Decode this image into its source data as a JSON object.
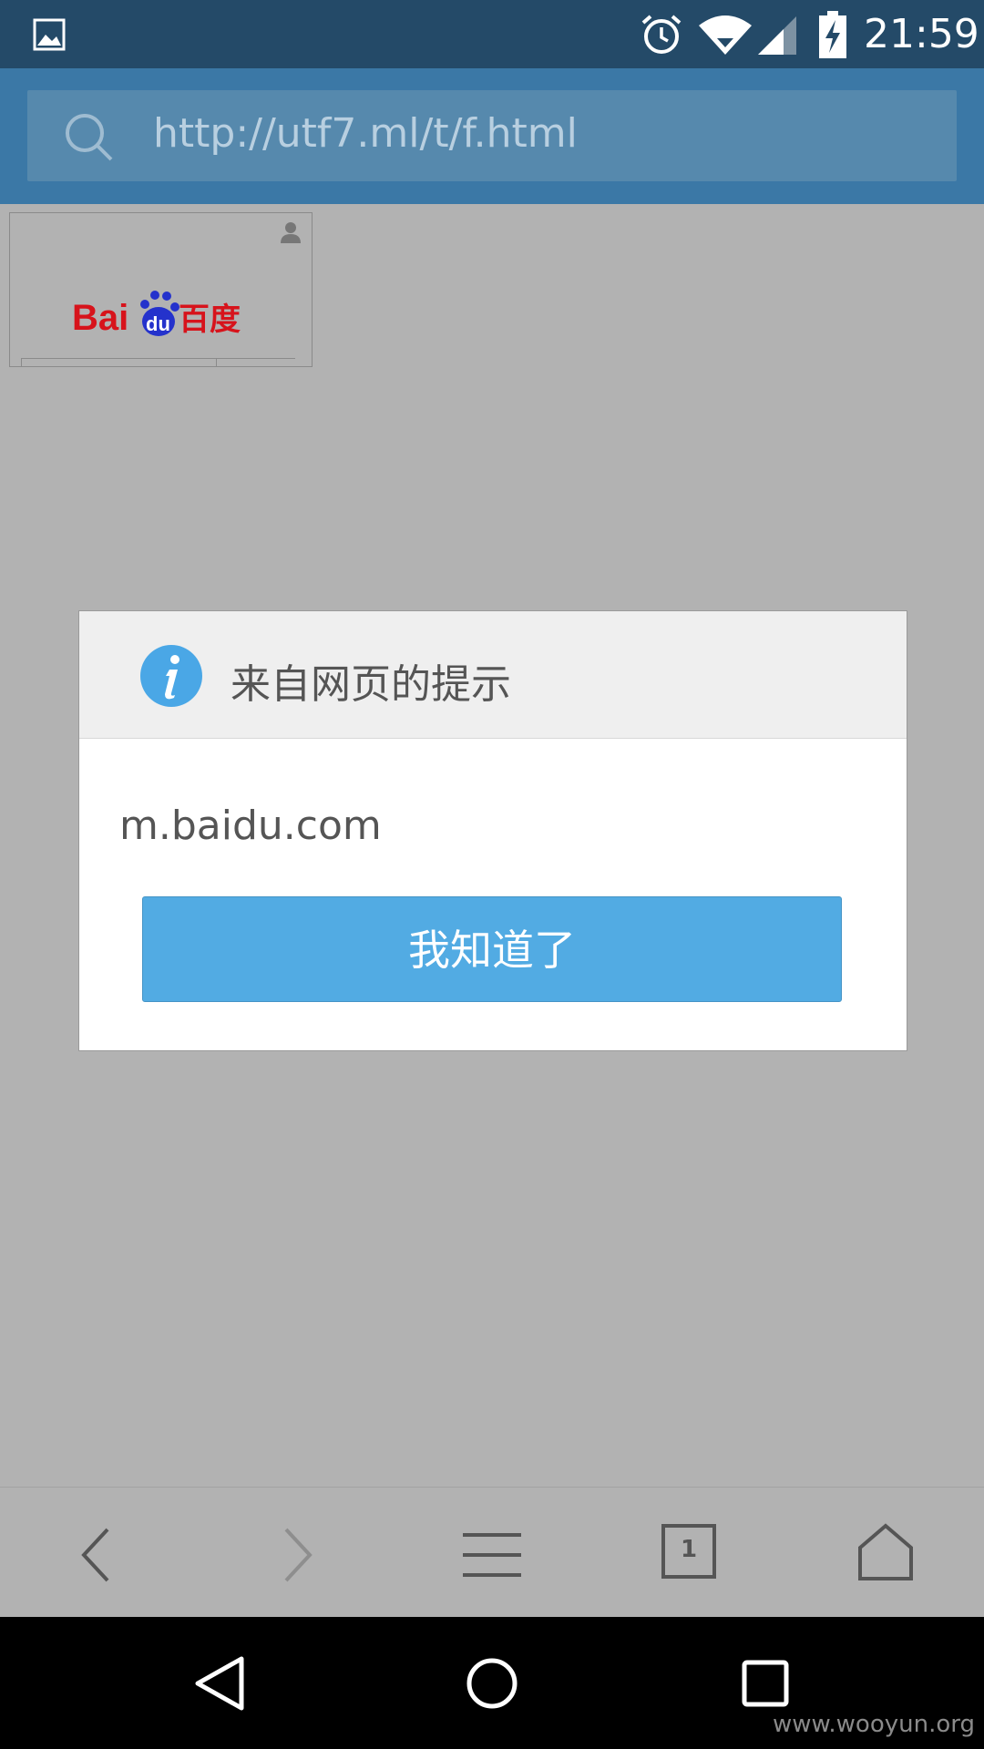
{
  "status_bar": {
    "time": "21:59",
    "icons": [
      "image-icon",
      "alarm-icon",
      "wifi-icon",
      "signal-icon",
      "battery-charging-icon"
    ]
  },
  "browser": {
    "url": "http://utf7.ml/t/f.html",
    "tab_count": "1",
    "toolbar_icons": [
      "back-icon",
      "forward-icon",
      "menu-icon",
      "tabs-icon",
      "home-icon"
    ]
  },
  "page": {
    "logo_text": "Bai du 百度"
  },
  "dialog": {
    "title": "来自网页的提示",
    "message": "m.baidu.com",
    "button_label": "我知道了"
  },
  "watermark": "www.wooyun.org",
  "colors": {
    "status_bar": "#244a68",
    "url_bar": "#3b78a6",
    "button": "#52abe3",
    "info_icon": "#4aa7e6",
    "logo_red": "#d7131b",
    "logo_blue": "#2432cc"
  }
}
